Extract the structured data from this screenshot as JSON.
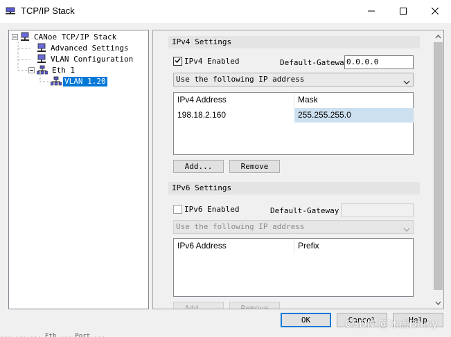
{
  "window": {
    "title": "TCP/IP Stack",
    "icon": "network-stack-icon",
    "minimize_symbol": "—",
    "maximize_symbol": "☐",
    "close_symbol": "✕"
  },
  "tree": {
    "items": [
      {
        "label": "CANoe TCP/IP Stack",
        "icon": "computer-icon",
        "expander": "⊟"
      },
      {
        "label": "Advanced Settings",
        "icon": "computer-icon"
      },
      {
        "label": "VLAN Configuration",
        "icon": "computer-icon"
      },
      {
        "label": "Eth 1",
        "icon": "network-icon",
        "expander": "⊟"
      },
      {
        "label": "VLAN 1.20",
        "icon": "network-icon"
      }
    ]
  },
  "ipv4": {
    "section_title": "IPv4 Settings",
    "enabled_label": "IPv4 Enabled",
    "enabled_checked": true,
    "gateway_label": "Default-Gateway:",
    "gateway_value": "0.0.0.0",
    "mode_value": "Use the following IP address",
    "table_headers": [
      "IPv4 Address",
      "Mask"
    ],
    "table_rows": [
      {
        "address": "198.18.2.160",
        "mask": "255.255.255.0"
      }
    ],
    "add_label": "Add...",
    "remove_label": "Remove"
  },
  "ipv6": {
    "section_title": "IPv6 Settings",
    "enabled_label": "IPv6 Enabled",
    "enabled_checked": false,
    "gateway_label": "Default-Gateway:",
    "gateway_value": "",
    "mode_value": "Use the following IP address",
    "table_headers": [
      "IPv6 Address",
      "Prefix"
    ],
    "add_label": "Add...",
    "remove_label": "Remove"
  },
  "dialog_buttons": {
    "ok_label": "OK",
    "cancel_label": "Cancel",
    "help_label": "Help"
  },
  "watermark": "CSDN @冰点Daisy",
  "bottom_strip_text": "...  ...  ...  Eth  ...  Port  ..."
}
